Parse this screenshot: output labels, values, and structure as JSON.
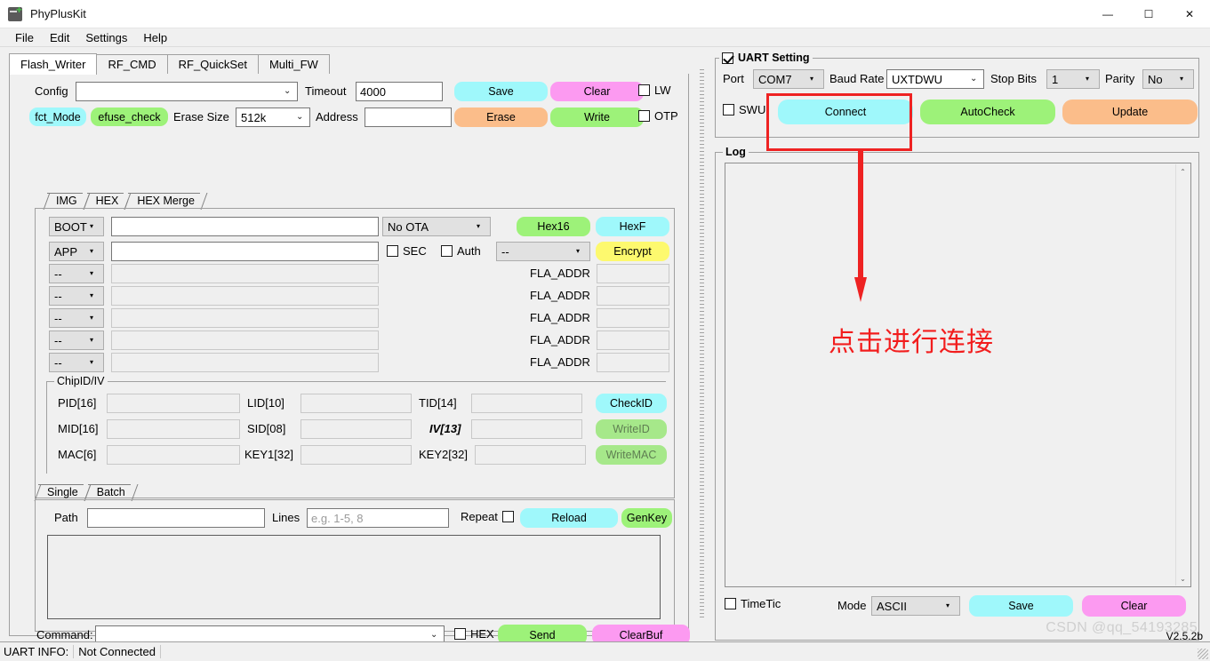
{
  "window": {
    "title": "PhyPlusKit",
    "icon": "app-icon",
    "minimize": "—",
    "maximize": "☐",
    "close": "✕"
  },
  "menubar": {
    "items": [
      "File",
      "Edit",
      "Settings",
      "Help"
    ]
  },
  "main_tabs": [
    {
      "label": "Flash_Writer",
      "active": true
    },
    {
      "label": "RF_CMD",
      "active": false
    },
    {
      "label": "RF_QuickSet",
      "active": false
    },
    {
      "label": "Multi_FW",
      "active": false
    }
  ],
  "toolbar": {
    "config_label": "Config",
    "config_value": "",
    "timeout_label": "Timeout",
    "timeout_value": "4000",
    "save_label": "Save",
    "clear_label": "Clear",
    "lw_label": "LW",
    "lw_checked": false,
    "fct_mode_label": "fct_Mode",
    "efuse_check_label": "efuse_check",
    "erase_size_label": "Erase Size",
    "erase_size_value": "512k",
    "address_label": "Address",
    "address_value": "",
    "erase_label": "Erase",
    "write_label": "Write",
    "otp_label": "OTP",
    "otp_checked": false
  },
  "image_tabs": [
    {
      "label": "IMG",
      "active": false
    },
    {
      "label": "HEX",
      "active": false
    },
    {
      "label": "HEX Merge",
      "active": true
    }
  ],
  "hex_merge": {
    "rows": [
      {
        "type": "BOOT",
        "path": "",
        "disabled": false
      },
      {
        "type": "APP",
        "path": "",
        "disabled": false
      },
      {
        "type": "--",
        "path": "",
        "disabled": true,
        "fla_label": "FLA_ADDR",
        "fla_value": ""
      },
      {
        "type": "--",
        "path": "",
        "disabled": true,
        "fla_label": "FLA_ADDR",
        "fla_value": ""
      },
      {
        "type": "--",
        "path": "",
        "disabled": true,
        "fla_label": "FLA_ADDR",
        "fla_value": ""
      },
      {
        "type": "--",
        "path": "",
        "disabled": true,
        "fla_label": "FLA_ADDR",
        "fla_value": ""
      },
      {
        "type": "--",
        "path": "",
        "disabled": true,
        "fla_label": "FLA_ADDR",
        "fla_value": ""
      }
    ],
    "ota_value": "No OTA",
    "hex16_label": "Hex16",
    "hexf_label": "HexF",
    "sec_label": "SEC",
    "sec_checked": false,
    "auth_label": "Auth",
    "auth_checked": false,
    "auth_combo_value": "--",
    "encrypt_label": "Encrypt"
  },
  "chipid": {
    "group_title": "ChipID/IV",
    "fields": [
      {
        "label": "PID[16]",
        "value": ""
      },
      {
        "label": "LID[10]",
        "value": ""
      },
      {
        "label": "TID[14]",
        "value": ""
      },
      {
        "label": "MID[16]",
        "value": ""
      },
      {
        "label": "SID[08]",
        "value": ""
      },
      {
        "label": "IV[13]",
        "value": ""
      },
      {
        "label": "MAC[6]",
        "value": ""
      },
      {
        "label": "KEY1[32]",
        "value": ""
      },
      {
        "label": "KEY2[32]",
        "value": ""
      }
    ],
    "checkid_label": "CheckID",
    "writeid_label": "WriteID",
    "writemac_label": "WriteMAC"
  },
  "batch": {
    "tabs": [
      {
        "label": "Single",
        "active": false
      },
      {
        "label": "Batch",
        "active": true
      }
    ],
    "path_label": "Path",
    "path_value": "",
    "lines_label": "Lines",
    "lines_placeholder": "e.g. 1-5, 8",
    "repeat_label": "Repeat",
    "repeat_checked": false,
    "reload_label": "Reload",
    "genkey_label": "GenKey",
    "list_value": ""
  },
  "command": {
    "label": "Command:",
    "value": "",
    "hex_label": "HEX",
    "hex_checked": false,
    "send_label": "Send",
    "clearbuf_label": "ClearBuf"
  },
  "uart": {
    "group_title": "UART Setting",
    "group_checked": true,
    "port_label": "Port",
    "port_value": "COM7",
    "baud_label": "Baud Rate",
    "baud_value": "UXTDWU",
    "stopbits_label": "Stop Bits",
    "stopbits_value": "1",
    "parity_label": "Parity",
    "parity_value": "No",
    "swu_label": "SWU",
    "swu_checked": false,
    "connect_label": "Connect",
    "autocheck_label": "AutoCheck",
    "update_label": "Update"
  },
  "log": {
    "group_title": "Log",
    "content": "",
    "timetic_label": "TimeTic",
    "timetic_checked": false,
    "mode_label": "Mode",
    "mode_value": "ASCII",
    "save_label": "Save",
    "clear_label": "Clear"
  },
  "annotation": {
    "text": "点击进行连接",
    "color": "#f21d1d"
  },
  "statusbar": {
    "label": "UART INFO:",
    "value": "Not Connected"
  },
  "watermark": "CSDN @qq_54193285",
  "version": "V2.5.2b",
  "icons": {
    "chevron_down": "⌄",
    "caret_down": "▾",
    "scroll_up": "⌃",
    "scroll_down": "⌄"
  }
}
